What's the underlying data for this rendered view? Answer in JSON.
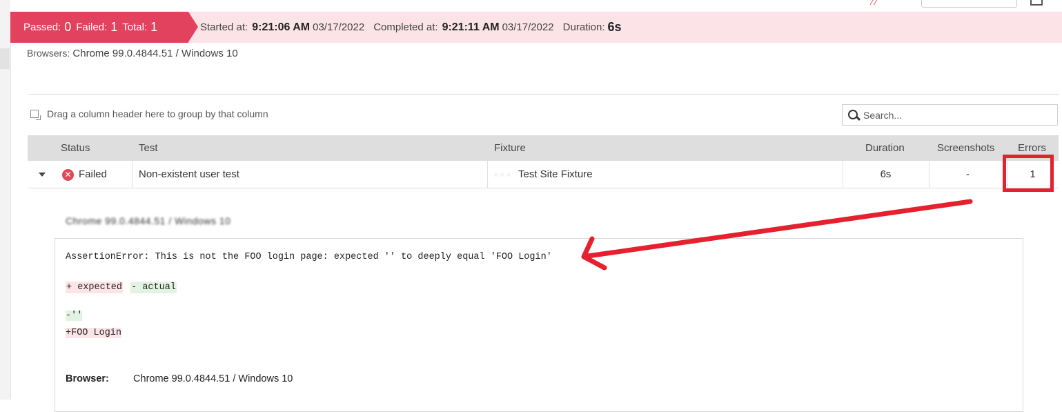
{
  "summary": {
    "passed_label": "Passed:",
    "passed_value": "0",
    "failed_label": "Failed:",
    "failed_value": "1",
    "total_label": "Total:",
    "total_value": "1",
    "started_label": "Started at:",
    "started_time": "9:21:06 AM",
    "started_date": "03/17/2022",
    "completed_label": "Completed at:",
    "completed_time": "9:21:11 AM",
    "completed_date": "03/17/2022",
    "duration_label": "Duration:",
    "duration_value": "6s"
  },
  "browsers": {
    "label": "Browsers:",
    "value": "Chrome 99.0.4844.51 / Windows 10"
  },
  "grid": {
    "group_hint": "Drag a column header here to group by that column",
    "search_placeholder": "Search...",
    "columns": [
      "Status",
      "Test",
      "Fixture",
      "Duration",
      "Screenshots",
      "Errors"
    ],
    "rows": [
      {
        "status": "Failed",
        "test": "Non-existent user test",
        "fixture_prefix": "· · ·",
        "fixture": "Test Site Fixture",
        "duration": "6s",
        "screenshots": "-",
        "errors": "1"
      }
    ]
  },
  "detail": {
    "browser_heading": "Chrome 99.0.4844.51 / Windows 10",
    "error_message": "AssertionError: This is not the FOO login page: expected '' to deeply equal 'FOO Login'",
    "diff_expected_label": "+ expected",
    "diff_actual_label": "- actual",
    "diff_minus_line": "-''",
    "diff_plus_line": "+FOO Login",
    "browser_label": "Browser:",
    "browser_value": "Chrome 99.0.4844.51 / Windows 10"
  },
  "colors": {
    "summary_badge": "#e2425e",
    "summary_bar": "#fbe3e8",
    "annotation_red": "#e5212f",
    "expected_bg": "#fde4e8",
    "actual_bg": "#e3f3e3"
  },
  "icons": {
    "status_failed": "x-circle-icon",
    "search": "search-icon",
    "group": "group-by-icon",
    "expand": "caret-down-icon"
  }
}
